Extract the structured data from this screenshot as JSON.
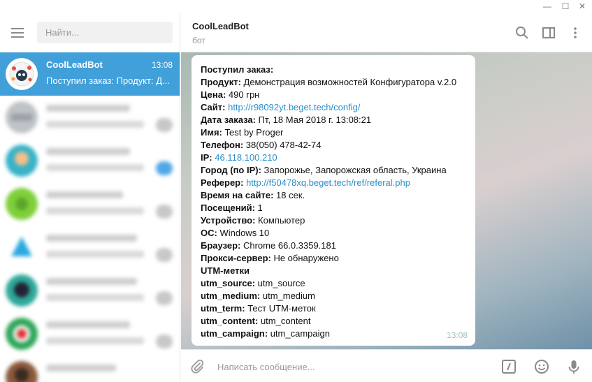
{
  "window": {
    "minimize": "—",
    "maximize": "☐",
    "close": "✕"
  },
  "search": {
    "placeholder": "Найти..."
  },
  "chats": [
    {
      "name": "CoolLeadBot",
      "time": "13:08",
      "preview": "Поступил заказ: Продукт: Д..."
    }
  ],
  "header": {
    "title": "CoolLeadBot",
    "subtitle": "бот"
  },
  "message": {
    "time": "13:08",
    "lines": [
      {
        "label": "Поступил заказ:",
        "value": ""
      },
      {
        "label": "Продукт:",
        "value": " Демонстрация возможностей Конфигуратора v.2.0"
      },
      {
        "label": "Цена:",
        "value": " 490 грн"
      },
      {
        "label": "Сайт:",
        "value": " ",
        "link": "http://r98092yt.beget.tech/config/"
      },
      {
        "label": "Дата заказа:",
        "value": " Пт, 18 Мая 2018 г. 13:08:21"
      },
      {
        "label": "Имя:",
        "value": " Test by Proger"
      },
      {
        "label": "Телефон:",
        "value": "  38(050) 478-42-74"
      },
      {
        "label": "IP:",
        "value": " ",
        "link": "46.118.100.210"
      },
      {
        "label": "Город (по IP):",
        "value": " Запорожье, Запорожская область, Украина"
      },
      {
        "label": "Реферер:",
        "value": " ",
        "link": "http://f50478xq.beget.tech/ref/referal.php"
      },
      {
        "label": "Время на сайте:",
        "value": " 18 сек."
      },
      {
        "label": "Посещений:",
        "value": " 1"
      },
      {
        "label": "Устройство:",
        "value": " Компьютер"
      },
      {
        "label": "ОС:",
        "value": " Windows 10"
      },
      {
        "label": "Браузер:",
        "value": " Chrome 66.0.3359.181"
      },
      {
        "label": "Прокси-сервер:",
        "value": " Не обнаружено"
      },
      {
        "label": "UTM-метки",
        "value": ""
      },
      {
        "label": "utm_source:",
        "value": " utm_source"
      },
      {
        "label": "utm_medium:",
        "value": " utm_medium"
      },
      {
        "label": "utm_term:",
        "value": " Тест UTM-меток"
      },
      {
        "label": "utm_content:",
        "value": " utm_content"
      },
      {
        "label": "utm_campaign:",
        "value": " utm_campaign"
      }
    ]
  },
  "composer": {
    "placeholder": "Написать сообщение..."
  },
  "icons": {
    "menu": "hamburger-icon",
    "search": "search-icon",
    "sidebar_toggle": "columns-icon",
    "more": "more-vertical-icon",
    "attach": "paperclip-icon",
    "commands": "slash-command-icon",
    "emoji": "smile-icon",
    "voice": "microphone-icon"
  },
  "colors": {
    "accent": "#419fd9",
    "link": "#2a8fc9"
  }
}
